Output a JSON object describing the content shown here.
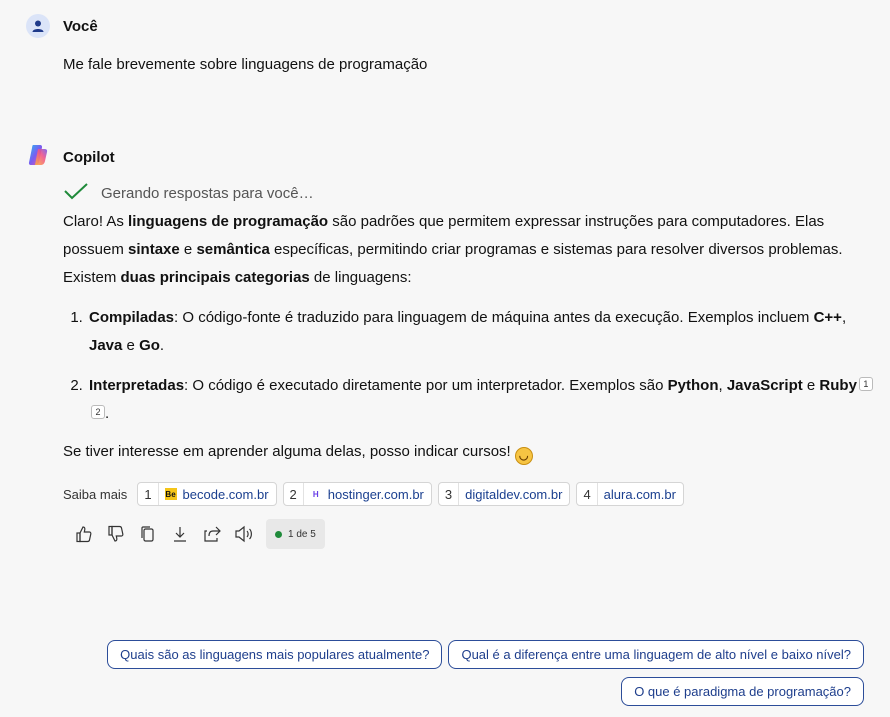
{
  "user": {
    "name": "Você",
    "message": "Me fale brevemente sobre linguagens de programação"
  },
  "bot": {
    "name": "Copilot",
    "status": "Gerando respostas para você…",
    "intro": {
      "p1": "Claro! As ",
      "b1": "linguagens de programação",
      "p2": " são padrões que permitem expressar instruções para computadores. Elas possuem ",
      "b2": "sintaxe",
      "p3": " e ",
      "b3": "semântica",
      "p4": " específicas, permitindo criar programas e sistemas para resolver diversos problemas. Existem ",
      "b4": "duas principais categorias",
      "p5": " de linguagens:"
    },
    "list": [
      {
        "title": "Compiladas",
        "text": ": O código-fonte é traduzido para linguagem de máquina antes da execução. Exemplos incluem ",
        "ex1": "C++",
        "sep1": ", ",
        "ex2": "Java",
        "sep2": " e ",
        "ex3": "Go",
        "end": "."
      },
      {
        "title": "Interpretadas",
        "text": ": O código é executado diretamente por um interpretador. Exemplos são ",
        "ex1": "Python",
        "sep1": ", ",
        "ex2": "JavaScript",
        "sep2": " e ",
        "ex3": "Ruby",
        "cite1": "1",
        "cite2": "2",
        "end": "."
      }
    ],
    "closing": "Se tiver interesse em aprender alguma delas, posso indicar cursos!",
    "sources_label": "Saiba mais",
    "sources": [
      {
        "num": "1",
        "domain": "becode.com.br",
        "favicon": "Be"
      },
      {
        "num": "2",
        "domain": "hostinger.com.br",
        "favicon": "H"
      },
      {
        "num": "3",
        "domain": "digitaldev.com.br",
        "favicon": ""
      },
      {
        "num": "4",
        "domain": "alura.com.br",
        "favicon": ""
      }
    ],
    "pager": "1 de 5"
  },
  "suggestions": [
    "Quais são as linguagens mais populares atualmente?",
    "Qual é a diferença entre uma linguagem de alto nível e baixo nível?",
    "O que é paradigma de programação?"
  ],
  "colors": {
    "accent": "#2c4d99",
    "success": "#1f8a3a",
    "background": "#f7f7f7"
  }
}
